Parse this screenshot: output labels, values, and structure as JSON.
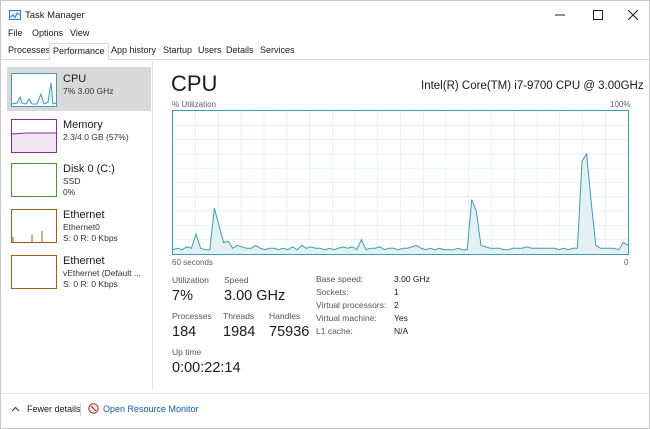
{
  "window": {
    "title": "Task Manager"
  },
  "menu": [
    "File",
    "Options",
    "View"
  ],
  "tabs": [
    "Processes",
    "Performance",
    "App history",
    "Startup",
    "Users",
    "Details",
    "Services"
  ],
  "sidebar": [
    {
      "name": "CPU",
      "lines": [
        "7% 3.00 GHz"
      ]
    },
    {
      "name": "Memory",
      "lines": [
        "2.3/4.0 GB (57%)"
      ]
    },
    {
      "name": "Disk 0 (C:)",
      "lines": [
        "SSD",
        "0%"
      ]
    },
    {
      "name": "Ethernet",
      "lines": [
        "Ethernet0",
        "S: 0 R: 0 Kbps"
      ]
    },
    {
      "name": "Ethernet",
      "lines": [
        "vEthernet (Default ...",
        "S: 0 R: 0 Kbps"
      ]
    }
  ],
  "main": {
    "title": "CPU",
    "model": "Intel(R) Core(TM) i7-9700 CPU @ 3.00GHz",
    "util_label": "% Utilization",
    "max_label": "100%",
    "time_label": "60 seconds",
    "zero_label": "0",
    "stats": {
      "utilization_label": "Utilization",
      "utilization": "7%",
      "speed_label": "Speed",
      "speed": "3.00 GHz",
      "processes_label": "Processes",
      "processes": "184",
      "threads_label": "Threads",
      "threads": "1984",
      "handles_label": "Handles",
      "handles": "75936",
      "uptime_label": "Up time",
      "uptime": "0:00:22:14"
    },
    "details": [
      {
        "label": "Base speed:",
        "value": "3.00 GHz"
      },
      {
        "label": "Sockets:",
        "value": "1"
      },
      {
        "label": "Virtual processors:",
        "value": "2"
      },
      {
        "label": "Virtual machine:",
        "value": "Yes"
      },
      {
        "label": "L1 cache:",
        "value": "N/A"
      }
    ]
  },
  "footer": {
    "fewer_details": "Fewer details",
    "resource_monitor": "Open Resource Monitor"
  },
  "colors": {
    "cpu": "#3e9db2",
    "memory": "#8b2d8f",
    "disk": "#4a9a2f",
    "ethernet": "#a75a1c"
  },
  "chart_data": {
    "type": "area",
    "ylim": [
      0,
      100
    ],
    "x_span_seconds": 60,
    "values": [
      3,
      4,
      3,
      5,
      4,
      14,
      4,
      3,
      3,
      32,
      20,
      8,
      9,
      4,
      6,
      5,
      4,
      4,
      6,
      4,
      3,
      4,
      4,
      3,
      4,
      3,
      5,
      3,
      6,
      4,
      5,
      4,
      4,
      3,
      4,
      3,
      4,
      5,
      4,
      5,
      3,
      10,
      3,
      4,
      4,
      5,
      3,
      4,
      4,
      3,
      4,
      4,
      5,
      6,
      4,
      3,
      4,
      3,
      4,
      3,
      3,
      3,
      4,
      3,
      3,
      38,
      30,
      6,
      5,
      4,
      4,
      4,
      3,
      3,
      4,
      4,
      4,
      5,
      4,
      4,
      4,
      4,
      4,
      4,
      3,
      4,
      3,
      4,
      4,
      65,
      70,
      36,
      6,
      4,
      4,
      4,
      4,
      3,
      8,
      6
    ]
  }
}
